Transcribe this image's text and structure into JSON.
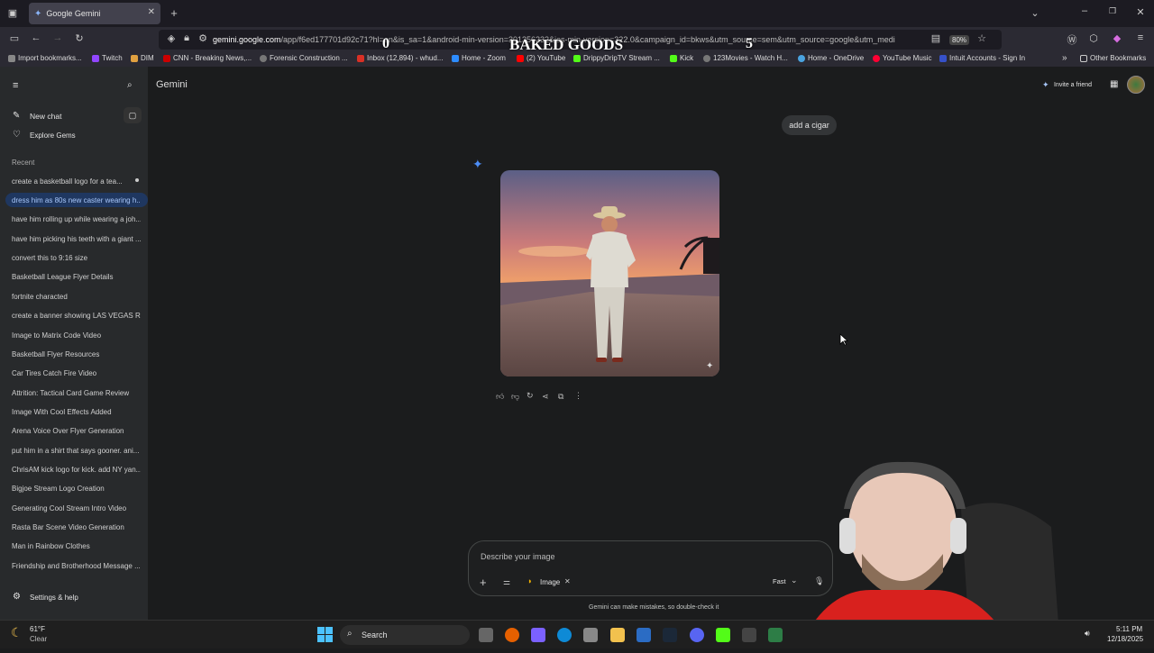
{
  "browser": {
    "tab_title": "Google Gemini",
    "url_domain": "gemini.google.com",
    "url_rest": "/app/f6ed177701d92c71?hl=en&is_sa=1&android-min-version=301356232&ios-min-version=322.0&campaign_id=bkws&utm_source=sem&utm_source=google&utm_medi",
    "zoom": "80%",
    "bookmarks": [
      "Import bookmarks...",
      "Twitch",
      "DIM",
      "CNN - Breaking News,...",
      "Forensic Construction ...",
      "Inbox (12,894) - whud...",
      "Home - Zoom",
      "(2) YouTube",
      "DrippyDripTV Stream ...",
      "Kick",
      "123Movies - Watch H...",
      "Home - OneDrive",
      "YouTube Music",
      "Intuit Accounts - Sign In"
    ],
    "other_bookmarks": "Other Bookmarks"
  },
  "overlay": {
    "left_score": "0",
    "title": "BAKED GOODS",
    "right_score": "5"
  },
  "sidebar": {
    "new_chat": "New chat",
    "explore": "Explore Gems",
    "recent_label": "Recent",
    "items": [
      "create a basketball logo for a tea...",
      "dress him as 80s new caster wearing h...",
      "have him rolling up while wearing a joh...",
      "have him picking his teeth with a giant ...",
      "convert this to 9:16 size",
      "Basketball League Flyer Details",
      "fortnite characted",
      "create a banner showing LAS VEGAS R...",
      "Image to Matrix Code Video",
      "Basketball Flyer Resources",
      "Car Tires Catch Fire Video",
      "Attrition: Tactical Card Game Review",
      "Image With Cool Effects Added",
      "Arena Voice Over Flyer Generation",
      "put him in a shirt that says gooner. ani...",
      "ChrisAM kick logo for kick. add NY yan...",
      "Bigjoe Stream Logo Creation",
      "Generating Cool Stream Intro Video",
      "Rasta Bar Scene Video Generation",
      "Man in Rainbow Clothes",
      "Friendship and Brotherhood Message ..."
    ],
    "settings": "Settings & help"
  },
  "main": {
    "app_title": "Gemini",
    "invite": "Invite a friend",
    "user_message": "add a cigar",
    "input_placeholder": "Describe your image",
    "tool_chip": "Image",
    "mode": "Fast",
    "disclaimer": "Gemini can make mistakes, so double-check it"
  },
  "taskbar": {
    "weather_temp": "61°F",
    "weather_desc": "Clear",
    "search": "Search",
    "time": "5:11 PM",
    "date": "12/18/2025"
  }
}
